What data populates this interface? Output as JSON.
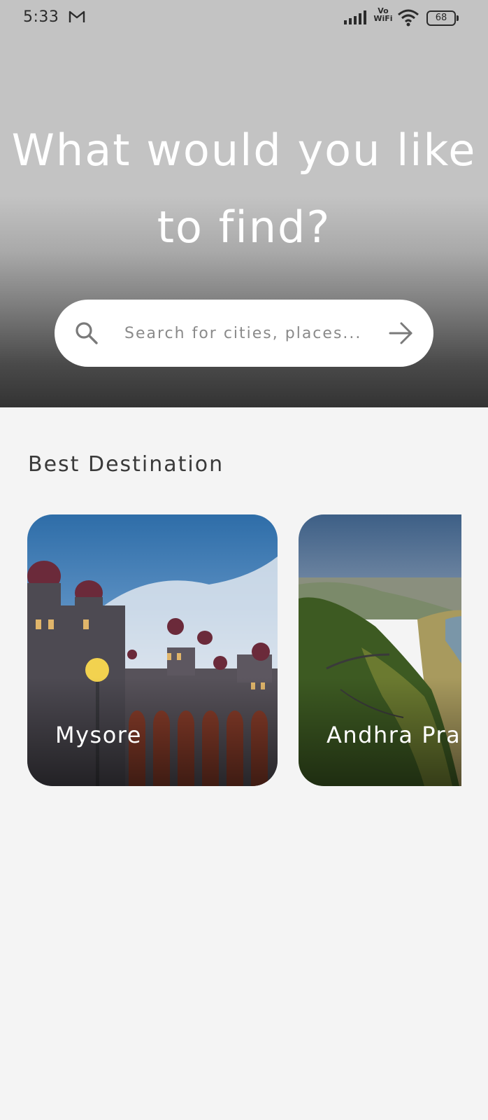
{
  "status_bar": {
    "time": "5:33",
    "network": "Vo\nWiFi",
    "battery": "68"
  },
  "hero": {
    "title_line1": "What would you like",
    "title_line2": "to find?"
  },
  "search": {
    "placeholder": "Search for cities, places..."
  },
  "section": {
    "title": "Best Destination"
  },
  "destinations": [
    {
      "label": "Mysore"
    },
    {
      "label": "Andhra Prad"
    }
  ],
  "colors": {
    "background": "#f4f4f4",
    "header_top": "#c3c3c3",
    "header_bottom": "#333333",
    "search_bg": "#ffffff"
  }
}
